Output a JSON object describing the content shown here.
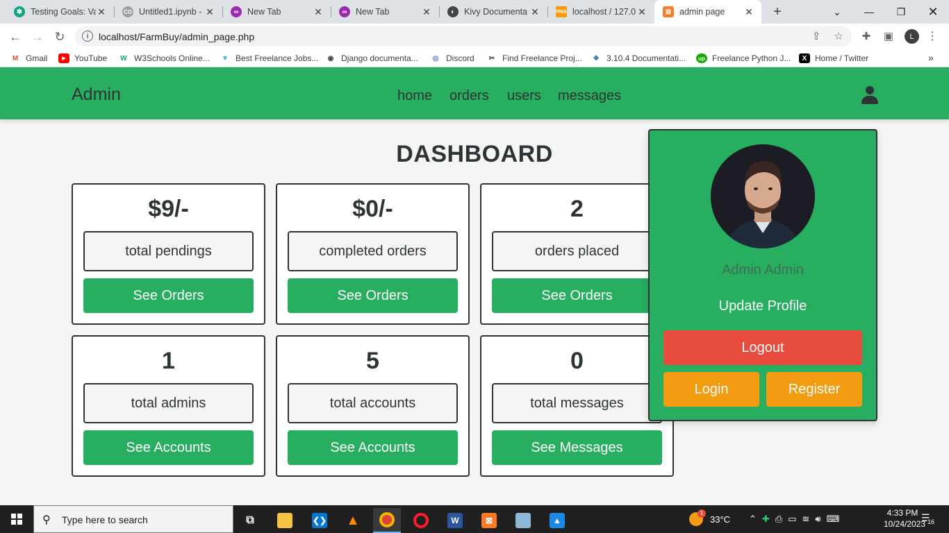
{
  "browser": {
    "tabs": [
      {
        "label": "Testing Goals: Va",
        "icon": "chatgpt-icon",
        "color": "#10a37f"
      },
      {
        "label": "Untitled1.ipynb -",
        "icon": "colab-icon",
        "color": "#f9ab00"
      },
      {
        "label": "New Tab",
        "icon": "newtab-icon",
        "color": "#9c27b0"
      },
      {
        "label": "New Tab",
        "icon": "newtab-icon",
        "color": "#9c27b0"
      },
      {
        "label": "Kivy Documenta",
        "icon": "kivy-icon",
        "color": "#444444"
      },
      {
        "label": "localhost / 127.0",
        "icon": "phpmyadmin-icon",
        "color": "#f89c0e"
      },
      {
        "label": "admin page",
        "icon": "xampp-icon",
        "color": "#fb7a24"
      }
    ],
    "url": "localhost/FarmBuy/admin_page.php",
    "profile_initial": "L",
    "bookmarks": [
      {
        "label": "Gmail",
        "icon": "gmail-icon"
      },
      {
        "label": "YouTube",
        "icon": "youtube-icon"
      },
      {
        "label": "W3Schools Online...",
        "icon": "w3schools-icon"
      },
      {
        "label": "Best Freelance Jobs...",
        "icon": "freelancer-icon"
      },
      {
        "label": "Django documenta...",
        "icon": "django-icon"
      },
      {
        "label": "Discord",
        "icon": "discord-icon"
      },
      {
        "label": "Find Freelance Proj...",
        "icon": "freelance-icon"
      },
      {
        "label": "3.10.4 Documentati...",
        "icon": "python-icon"
      },
      {
        "label": "Freelance Python J...",
        "icon": "upwork-icon"
      },
      {
        "label": "Home / Twitter",
        "icon": "x-icon"
      }
    ]
  },
  "header": {
    "logo": "Admin",
    "nav": [
      "home",
      "orders",
      "users",
      "messages"
    ]
  },
  "dashboard": {
    "title": "DASHBOARD",
    "cards": [
      {
        "value": "$9/-",
        "label": "total pendings",
        "button": "See Orders"
      },
      {
        "value": "$0/-",
        "label": "completed orders",
        "button": "See Orders"
      },
      {
        "value": "2",
        "label": "orders placed",
        "button": "See Orders"
      },
      {
        "value": "1",
        "label": "total admins",
        "button": "See Accounts"
      },
      {
        "value": "5",
        "label": "total accounts",
        "button": "See Accounts"
      },
      {
        "value": "0",
        "label": "total messages",
        "button": "See Messages"
      }
    ]
  },
  "profile": {
    "name": "Admin Admin",
    "update": "Update Profile",
    "logout": "Logout",
    "login": "Login",
    "register": "Register"
  },
  "taskbar": {
    "search_placeholder": "Type here to search",
    "weather": "33°C",
    "time": "4:33 PM",
    "date": "10/24/2023",
    "notification_count": "16",
    "weather_badge": "1"
  },
  "colors": {
    "primary_green": "#27ae60",
    "logout_red": "#e74c3c",
    "orange": "#f39c12",
    "dark": "#2d3436"
  }
}
